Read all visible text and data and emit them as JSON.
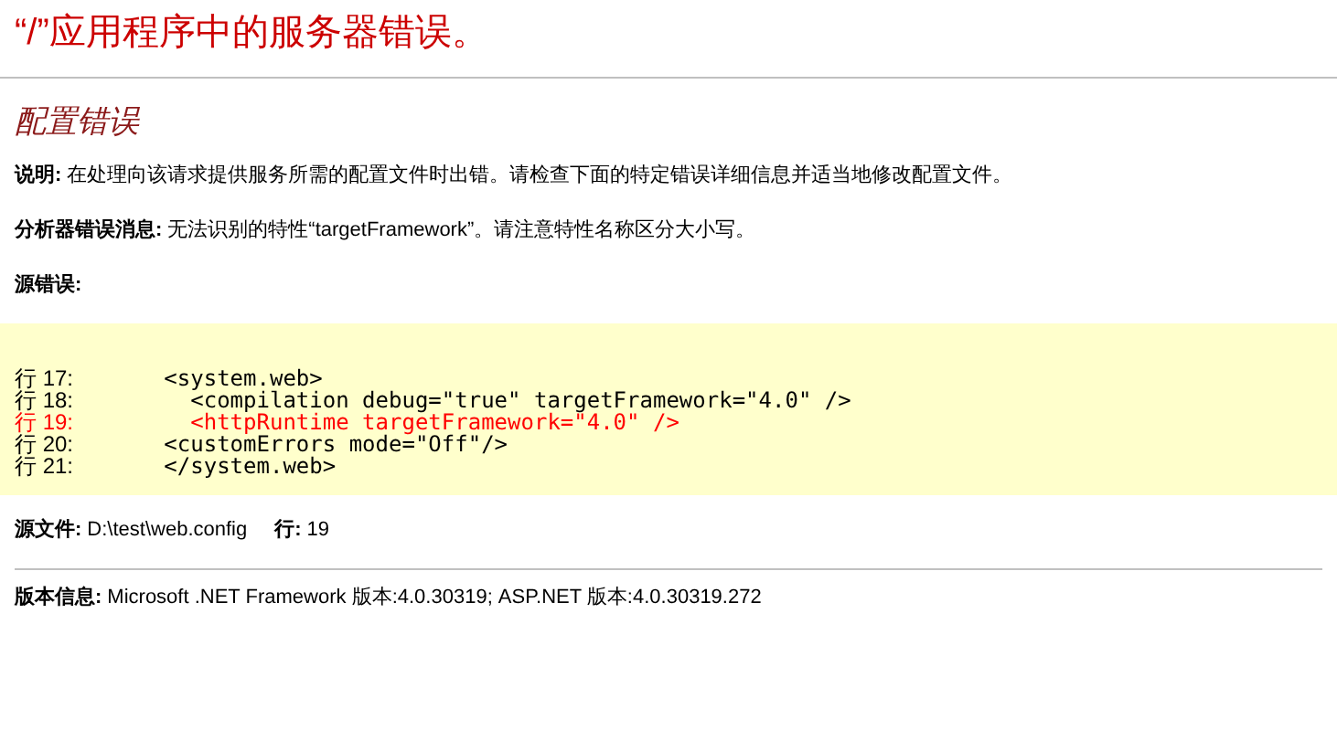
{
  "title": "“/”应用程序中的服务器错误。",
  "subtitle": "配置错误",
  "details": [
    {
      "label": "说明:",
      "text": "在处理向该请求提供服务所需的配置文件时出错。请检查下面的特定错误详细信息并适当地修改配置文件。"
    },
    {
      "label": "分析器错误消息:",
      "text": "无法识别的特性“targetFramework”。请注意特性名称区分大小写。"
    }
  ],
  "source_error_label": "源错误:",
  "code_lines": [
    {
      "line": "行 17:",
      "code": "   <system.web>",
      "highlighted": false
    },
    {
      "line": "行 18:",
      "code": "     <compilation debug=\"true\" targetFramework=\"4.0\" />",
      "highlighted": false
    },
    {
      "line": "行 19:",
      "code": "     <httpRuntime targetFramework=\"4.0\" />",
      "highlighted": true
    },
    {
      "line": "行 20:",
      "code": "   <customErrors mode=\"Off\"/>",
      "highlighted": false
    },
    {
      "line": "行 21:",
      "code": "   </system.web>",
      "highlighted": false
    }
  ],
  "source_file": {
    "label": "源文件:",
    "value": "D:\\test\\web.config",
    "line_label": "行:",
    "line_value": "19"
  },
  "version": {
    "label": "版本信息:",
    "value": "Microsoft .NET Framework 版本:4.0.30319; ASP.NET 版本:4.0.30319.272"
  }
}
